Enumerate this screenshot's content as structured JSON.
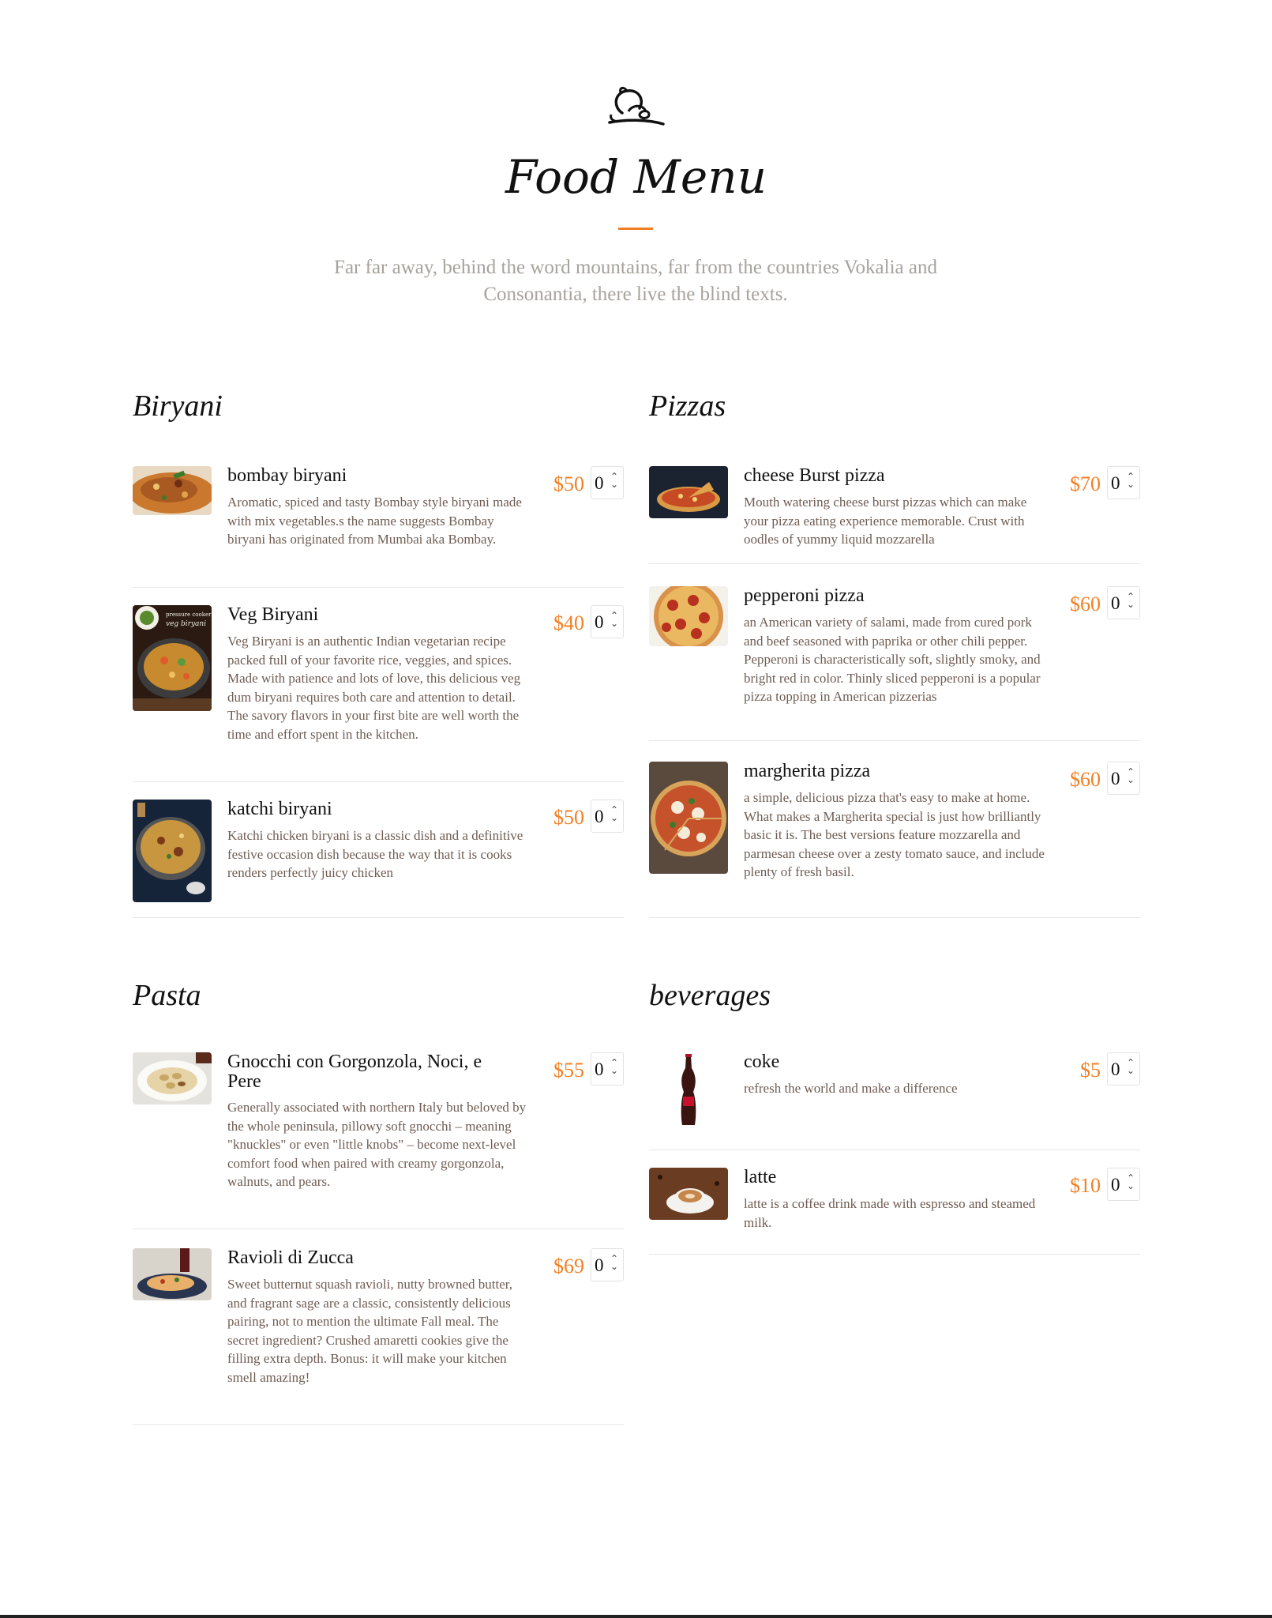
{
  "header": {
    "logo_icon": "serving-cloche-icon",
    "title": "Food Menu",
    "intro": "Far far away, behind the word mountains, far from the countries Vokalia and Consonantia, there live the blind texts."
  },
  "colors": {
    "accent": "#f27f24",
    "text_muted": "#a7a29c",
    "desc": "#6f5c52"
  },
  "sections": [
    {
      "title": "Biryani",
      "items": [
        {
          "name": "bombay biryani",
          "desc": "Aromatic, spiced and tasty Bombay style biryani made with mix vegetables.s the name suggests Bombay biryani has originated from Mumbai aka Bombay.",
          "price": "$50",
          "qty": "0",
          "image": "biryani-plate-photo"
        },
        {
          "name": "Veg Biryani",
          "desc": "Veg Biryani is an authentic Indian vegetarian recipe packed full of your favorite rice, veggies, and spices. Made with patience and lots of love, this delicious veg dum biryani requires both care and attention to detail. The savory flavors in your first bite are well worth the time and effort spent in the kitchen.",
          "price": "$40",
          "qty": "0",
          "image": "veg-biryani-photo",
          "image_caption_1": "pressure cooker",
          "image_caption_2": "veg biryani"
        },
        {
          "name": "katchi biryani",
          "desc": "Katchi chicken biryani is a classic dish and a definitive festive occasion dish because the way that it is cooks renders perfectly juicy chicken",
          "price": "$50",
          "qty": "0",
          "image": "katchi-biryani-photo"
        }
      ]
    },
    {
      "title": "Pizzas",
      "items": [
        {
          "name": "cheese Burst pizza",
          "desc": "Mouth watering cheese burst pizzas which can make your pizza eating experience memorable. Crust with oodles of yummy liquid mozzarella",
          "price": "$70",
          "qty": "0",
          "image": "cheese-burst-pizza-photo"
        },
        {
          "name": "pepperoni pizza",
          "desc": "an American variety of salami, made from cured pork and beef seasoned with paprika or other chili pepper. Pepperoni is characteristically soft, slightly smoky, and bright red in color. Thinly sliced pepperoni is a popular pizza topping in American pizzerias",
          "price": "$60",
          "qty": "0",
          "image": "pepperoni-pizza-photo"
        },
        {
          "name": "margherita pizza",
          "desc": "a simple, delicious pizza that's easy to make at home. What makes a Margherita special is just how brilliantly basic it is. The best versions feature mozzarella and parmesan cheese over a zesty tomato sauce, and include plenty of fresh basil.",
          "price": "$60",
          "qty": "0",
          "image": "margherita-pizza-photo"
        }
      ]
    },
    {
      "title": "Pasta",
      "items": [
        {
          "name": "Gnocchi con Gorgonzola, Noci, e Pere",
          "desc": "Generally associated with northern Italy but beloved by the whole peninsula, pillowy soft gnocchi – meaning \"knuckles\" or even \"little knobs\" – become next-level comfort food when paired with creamy gorgonzola, walnuts, and pears.",
          "price": "$55",
          "qty": "0",
          "image": "gnocchi-photo"
        },
        {
          "name": "Ravioli di Zucca",
          "desc": "Sweet butternut squash ravioli, nutty browned butter, and fragrant sage are a classic, consistently delicious pairing, not to mention the ultimate Fall meal. The secret ingredient? Crushed amaretti cookies give the filling extra depth. Bonus: it will make your kitchen smell amazing!",
          "price": "$69",
          "qty": "0",
          "image": "ravioli-photo"
        }
      ]
    },
    {
      "title": "beverages",
      "items": [
        {
          "name": "coke",
          "desc": "refresh the world and make a difference",
          "price": "$5",
          "qty": "0",
          "image": "coke-bottle-photo"
        },
        {
          "name": "latte",
          "desc": "latte is a coffee drink made with espresso and steamed milk.",
          "price": "$10",
          "qty": "0",
          "image": "latte-cup-photo"
        }
      ]
    }
  ]
}
